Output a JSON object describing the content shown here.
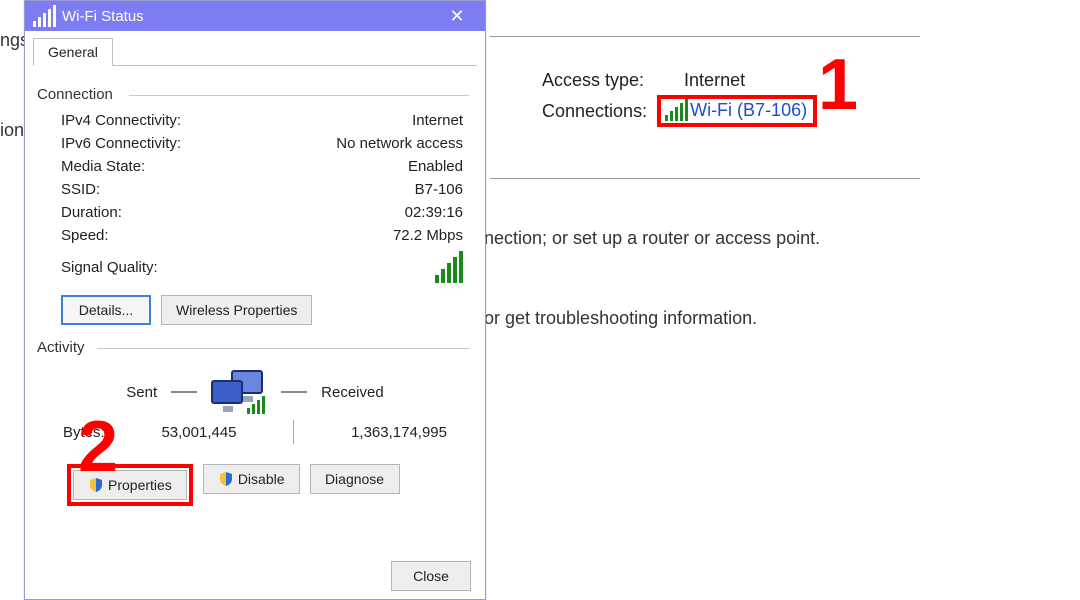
{
  "annotations": {
    "one": "1",
    "two": "2"
  },
  "background": {
    "frag_left_top": "ngs",
    "frag_left_mid": "ion",
    "line1": "nection; or set up a router or access point.",
    "line2": "or get troubleshooting information."
  },
  "right_panel": {
    "access_type_label": "Access type:",
    "access_type_value": "Internet",
    "connections_label": "Connections:",
    "wifi_link_text": "Wi-Fi (B7-106)"
  },
  "dialog": {
    "title": "Wi-Fi Status",
    "tab_general": "General",
    "group_connection": "Connection",
    "rows": {
      "ipv4_k": "IPv4 Connectivity:",
      "ipv4_v": "Internet",
      "ipv6_k": "IPv6 Connectivity:",
      "ipv6_v": "No network access",
      "media_k": "Media State:",
      "media_v": "Enabled",
      "ssid_k": "SSID:",
      "ssid_v": "B7-106",
      "dur_k": "Duration:",
      "dur_v": "02:39:16",
      "speed_k": "Speed:",
      "speed_v": "72.2 Mbps",
      "sig_k": "Signal Quality:"
    },
    "btn_details": "Details...",
    "btn_wireless": "Wireless Properties",
    "group_activity": "Activity",
    "activity": {
      "sent_label": "Sent",
      "recv_label": "Received",
      "bytes_label": "Bytes:",
      "sent_value": "53,001,445",
      "recv_value": "1,363,174,995"
    },
    "btn_properties": "Properties",
    "btn_disable": "Disable",
    "btn_diagnose": "Diagnose",
    "btn_close": "Close"
  }
}
